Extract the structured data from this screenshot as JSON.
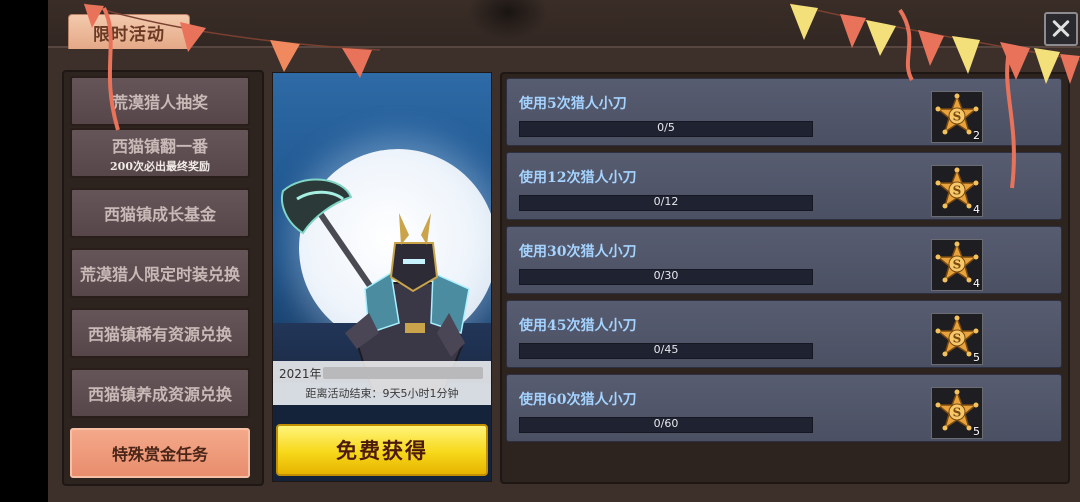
{
  "header": {
    "tab_label": "限时活动"
  },
  "sidebar": {
    "items": [
      {
        "label": "荒漠猎人抽奖",
        "sub": ""
      },
      {
        "label": "西猫镇翻一番",
        "sub": "200次必出最终奖励"
      },
      {
        "label": "西猫镇成长基金",
        "sub": ""
      },
      {
        "label": "荒漠猎人限定时装兑换",
        "sub": ""
      },
      {
        "label": "西猫镇稀有资源兑换",
        "sub": ""
      },
      {
        "label": "西猫镇养成资源兑换",
        "sub": ""
      },
      {
        "label": "特殊赏金任务",
        "sub": ""
      }
    ],
    "active_index": 6
  },
  "banner": {
    "year": "2021年",
    "end_text": "距离活动结束：9天5小时1分钟",
    "free_button": "免费获得"
  },
  "tasks": [
    {
      "title": "使用5次猎人小刀",
      "progress": "0/5",
      "fill": 0,
      "reward_icon": "sheriff-star-badge-icon",
      "reward_count": "2"
    },
    {
      "title": "使用12次猎人小刀",
      "progress": "0/12",
      "fill": 0,
      "reward_icon": "sheriff-star-badge-icon",
      "reward_count": "4"
    },
    {
      "title": "使用30次猎人小刀",
      "progress": "0/30",
      "fill": 0,
      "reward_icon": "sheriff-star-badge-icon",
      "reward_count": "4"
    },
    {
      "title": "使用45次猎人小刀",
      "progress": "0/45",
      "fill": 0,
      "reward_icon": "sheriff-star-badge-icon",
      "reward_count": "5"
    },
    {
      "title": "使用60次猎人小刀",
      "progress": "0/60",
      "fill": 0,
      "reward_icon": "sheriff-star-badge-icon",
      "reward_count": "5"
    }
  ],
  "colors": {
    "accent_tab": "#e4a987",
    "task_title": "#a5d3ff",
    "active_item": "#e88d6d",
    "button_yellow": "#f7d81a"
  }
}
